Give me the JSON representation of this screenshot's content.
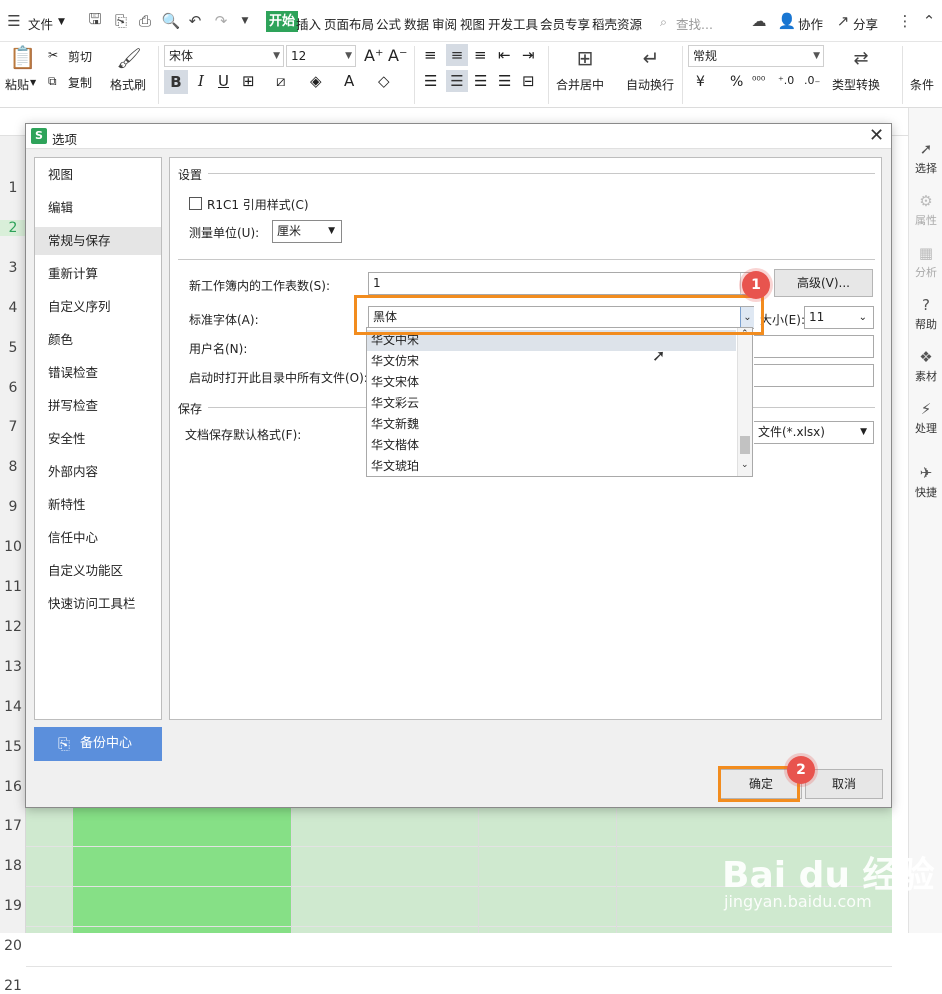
{
  "menubar": {
    "file_label": "文件",
    "tabs": [
      "开始",
      "插入",
      "页面布局",
      "公式",
      "数据",
      "审阅",
      "视图",
      "开发工具",
      "会员专享",
      "稻壳资源"
    ],
    "search_placeholder": "查找...",
    "collab_label": "协作",
    "share_label": "分享"
  },
  "ribbon": {
    "paste_label": "粘贴",
    "cut_label": "剪切",
    "copy_label": "复制",
    "format_painter_label": "格式刷",
    "font_name": "宋体",
    "font_size": "12",
    "bold_label": "B",
    "italic_label": "I",
    "underline_label": "U",
    "merge_center_label": "合并居中",
    "wrap_text_label": "自动换行",
    "number_format": "常规",
    "currency_label": "¥",
    "percent_label": "%",
    "type_convert_label": "类型转换",
    "conditional_label": "条件"
  },
  "rows": [
    "1",
    "2",
    "3",
    "4",
    "5",
    "6",
    "7",
    "8",
    "9",
    "10",
    "11",
    "12",
    "13",
    "14",
    "15",
    "16",
    "17",
    "18",
    "19",
    "20",
    "21"
  ],
  "rightbar": {
    "items": [
      "选择",
      "属性",
      "分析",
      "帮助",
      "素材",
      "处理",
      "快捷"
    ]
  },
  "dialog": {
    "title": "选项",
    "nav": [
      "视图",
      "编辑",
      "常规与保存",
      "重新计算",
      "自定义序列",
      "颜色",
      "错误检查",
      "拼写检查",
      "安全性",
      "外部内容",
      "新特性",
      "信任中心",
      "自定义功能区",
      "快速访问工具栏"
    ],
    "backup_label": "备份中心",
    "settings": {
      "section_title": "设置",
      "r1c1_label": "R1C1 引用样式(C)",
      "unit_label": "测量单位(U):",
      "unit_value": "厘米",
      "sheets_label": "新工作簿内的工作表数(S):",
      "sheets_value": "1",
      "advanced_label": "高级(V)...",
      "font_label": "标准字体(A):",
      "font_value": "黑体",
      "size_label": "大小(E):",
      "size_value": "11",
      "username_label": "用户名(N):",
      "startup_label": "启动时打开此目录中所有文件(O):"
    },
    "save": {
      "section_title": "保存",
      "format_label": "文档保存默认格式(F):",
      "format_value": "文件(*.xlsx)"
    },
    "font_options": [
      "华文中宋",
      "华文仿宋",
      "华文宋体",
      "华文彩云",
      "华文新魏",
      "华文楷体",
      "华文琥珀"
    ],
    "ok_label": "确定",
    "cancel_label": "取消"
  },
  "badges": [
    "1",
    "2"
  ],
  "watermark": {
    "brand": "Bai du 经验",
    "url": "jingyan.baidu.com"
  }
}
